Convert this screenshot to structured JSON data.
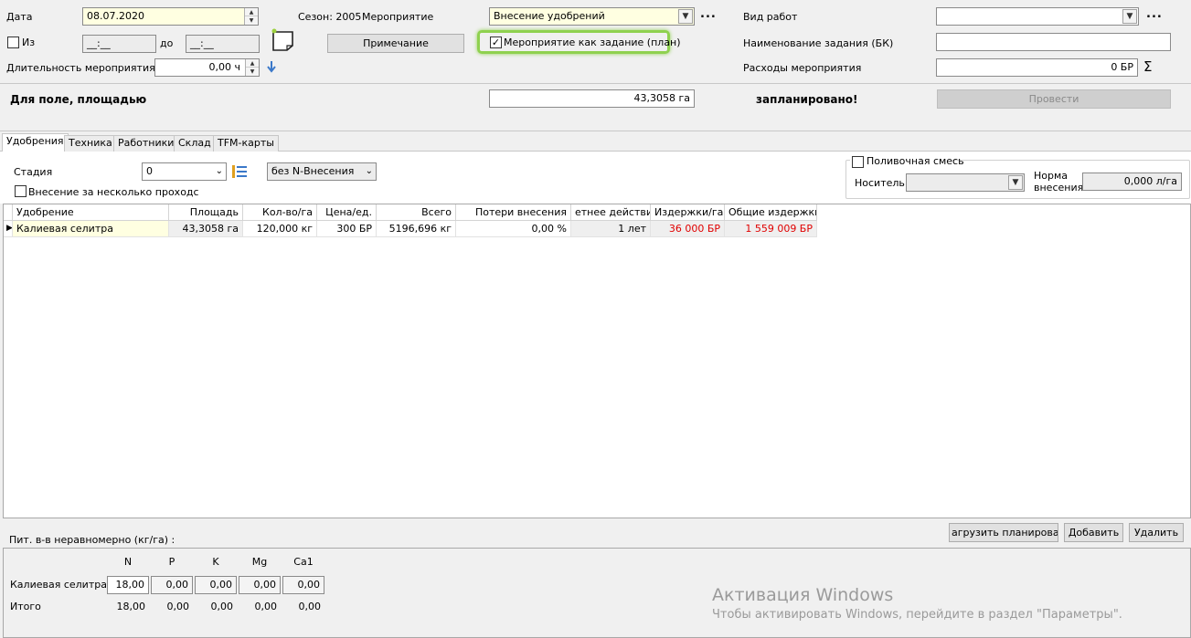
{
  "header": {
    "date_label": "Дата",
    "date_value": "08.07.2020",
    "season_text": "Сезон: 2005",
    "event_label": "Мероприятие",
    "event_value": "Внесение удобрений",
    "more_dots": "...",
    "work_type_label": "Вид работ",
    "work_type_value": "",
    "from_label": "Из",
    "from_time": "__:__",
    "to_label": "до",
    "to_time": "__:__",
    "note_button": "Примечание",
    "as_task_label": "Мероприятие как задание (план)",
    "as_task_checked": true,
    "task_name_label": "Наименование задания (БК)",
    "task_name_value": "",
    "duration_label": "Длительность мероприятия",
    "duration_value": "0,00 ч",
    "expenses_label": "Расходы мероприятия",
    "expenses_value": "0 БР",
    "sum_symbol": "Σ",
    "field_area_label": "Для поле, площадью",
    "field_area_value": "43,3058 га",
    "status_text": "запланировано!",
    "post_button": "Провести"
  },
  "tabs": [
    {
      "label": "Удобрения",
      "active": true
    },
    {
      "label": "Техника",
      "active": false
    },
    {
      "label": "Работники",
      "active": false
    },
    {
      "label": "Склад",
      "active": false
    },
    {
      "label": "TFM-карты",
      "active": false
    }
  ],
  "fert_panel": {
    "stage_label": "Стадия",
    "stage_value": "0",
    "n_mode_value": "без N-Внесения",
    "multi_pass_label": "Внесение за несколько проходс",
    "irrigation_label": "Поливочная смесь",
    "carrier_label": "Носитель",
    "carrier_value": "",
    "norm_label_1": "Норма",
    "norm_label_2": "внесения",
    "norm_value": "0,000 л/га"
  },
  "grid": {
    "columns": [
      "Удобрение",
      "Площадь",
      "Кол-во/га",
      "Цена/ед.",
      "Всего",
      "Потери внесения",
      "етнее действие",
      "Издержки/га",
      "Общие издержки"
    ],
    "rows": [
      [
        "Калиевая селитра",
        "43,3058 га",
        "120,000 кг",
        "300 БР",
        "5196,696 кг",
        "0,00 %",
        "1 лет",
        "36 000 БР",
        "1 559 009 БР"
      ]
    ],
    "cost_color": "#e00000"
  },
  "footer": {
    "uneven_label": "Пит. в-в неравномерно (кг/га) :",
    "load_plan_button": "агрузить планировани",
    "add_button": "Добавить",
    "delete_button": "Удалить"
  },
  "nutrients": {
    "headers": [
      "N",
      "P",
      "K",
      "Mg",
      "Ca1"
    ],
    "row_label": "Калиевая селитра",
    "row_values": [
      "18,00",
      "0,00",
      "0,00",
      "0,00",
      "0,00"
    ],
    "total_label": "Итого",
    "total_values": [
      "18,00",
      "0,00",
      "0,00",
      "0,00",
      "0,00"
    ]
  },
  "watermark": {
    "title": "Активация Windows",
    "subtitle": "Чтобы активировать Windows, перейдите в раздел \"Параметры\"."
  },
  "colors": {
    "highlight_ring": "#8fd14f",
    "input_yellow": "#ffffe1"
  }
}
